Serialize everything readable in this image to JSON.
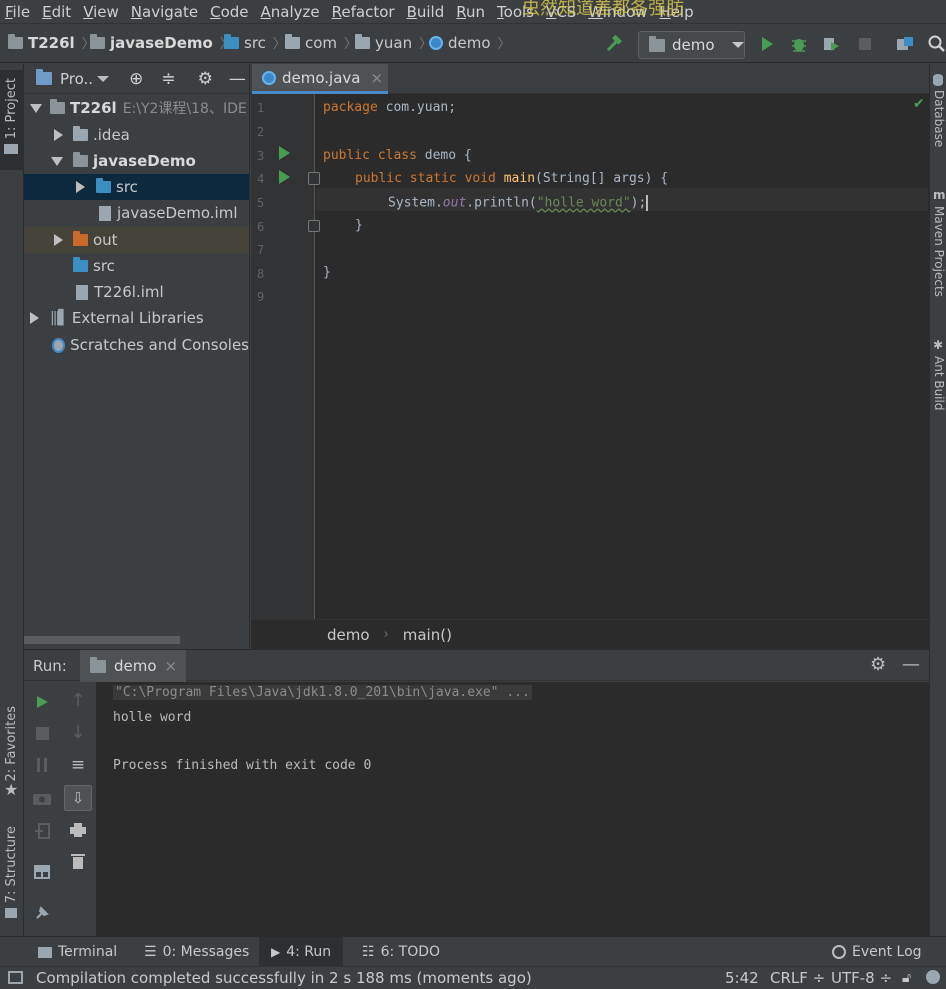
{
  "menu": [
    "File",
    "Edit",
    "View",
    "Navigate",
    "Code",
    "Analyze",
    "Refactor",
    "Build",
    "Run",
    "Tools",
    "VCS",
    "Window",
    "Help"
  ],
  "watermark_text": "虫然知道差都各强肪",
  "nav": {
    "project": "T226l",
    "module": "javaseDemo",
    "src": "src",
    "pkg1": "com",
    "pkg2": "yuan",
    "cls": "demo"
  },
  "run_config": "demo",
  "left_strip": {
    "project": "1: Project",
    "favorites": "2: Favorites",
    "structure": "7: Structure"
  },
  "right_strip": {
    "database": "Database",
    "maven": "Maven Projects",
    "ant": "Ant Build"
  },
  "project": {
    "header": "Pro..",
    "root": "T226l",
    "root_path": "E:\\Y2课程\\18、IDE",
    "idea": ".idea",
    "module": "javaseDemo",
    "src": "src",
    "iml": "javaseDemo.iml",
    "out": "out",
    "src2": "src",
    "root_iml": "T226l.iml",
    "ext_libs": "External Libraries",
    "scratches": "Scratches and Consoles"
  },
  "editor": {
    "tab": "demo.java",
    "line_numbers": [
      "1",
      "2",
      "3",
      "4",
      "5",
      "6",
      "7",
      "8",
      "9"
    ],
    "l1_kw": "package",
    "l1_rest": " com.yuan;",
    "l3_kw": "public class",
    "l3_rest": " demo {",
    "l4_kw": "public static void",
    "l4_fn": "main",
    "l4_rest": "(String[] args) {",
    "l5_a": "System.",
    "l5_out": "out",
    "l5_b": ".println(",
    "l5_str": "\"holle word\"",
    "l5_c": ");",
    "l6": "}",
    "l8": "}",
    "breadcrumb_cls": "demo",
    "breadcrumb_method": "main()"
  },
  "run": {
    "label": "Run:",
    "tab": "demo",
    "cmd": "\"C:\\Program Files\\Java\\jdk1.8.0_201\\bin\\java.exe\" ...",
    "out1": "holle word",
    "out2": "Process finished with exit code 0"
  },
  "bottom_tabs": {
    "terminal": "Terminal",
    "messages": "0: Messages",
    "run": "4: Run",
    "todo": "6: TODO",
    "eventlog": "Event Log"
  },
  "status": {
    "message": "Compilation completed successfully in 2 s 188 ms (moments ago)",
    "pos": "5:42",
    "crlf": "CRLF ÷",
    "enc": "UTF-8 ÷"
  },
  "colors": {
    "accent": "#4a88c7",
    "run_green": "#499c54",
    "bg_editor": "#2b2b2b",
    "bg_panel": "#3c3f41"
  }
}
